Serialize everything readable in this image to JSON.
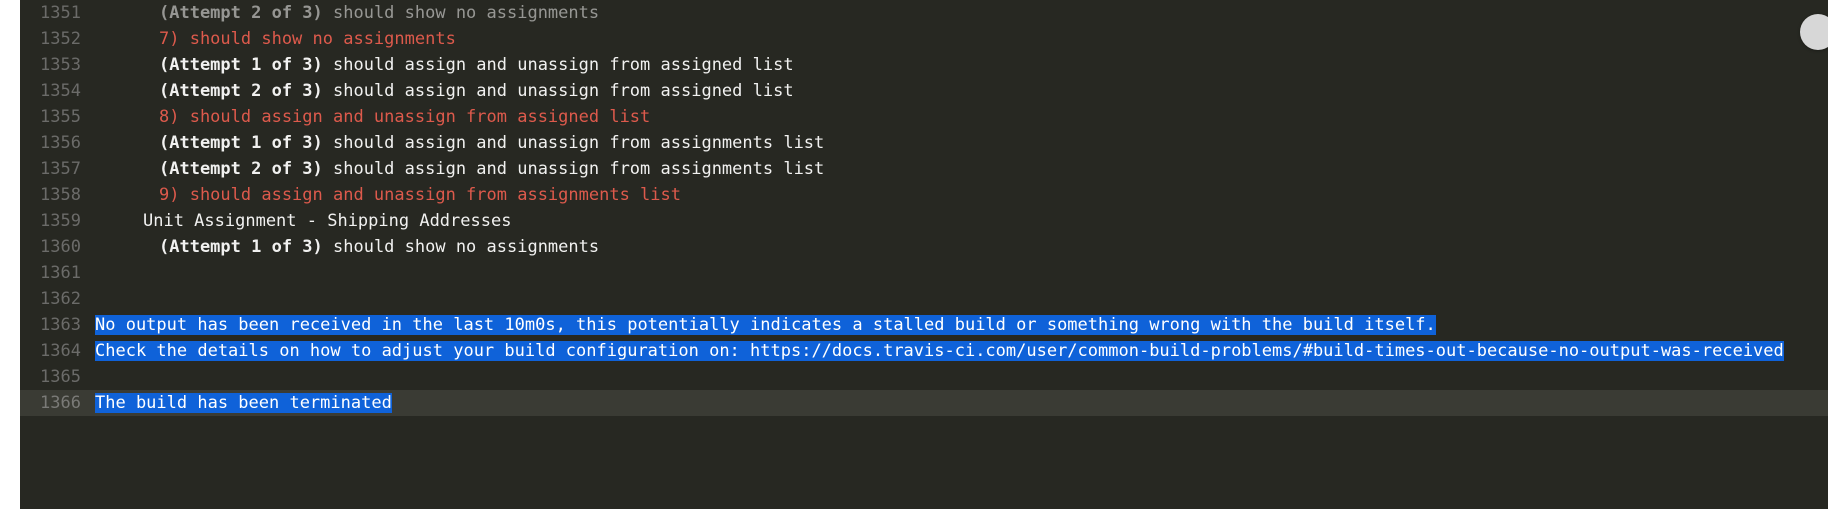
{
  "lines": [
    {
      "n": "1351",
      "cls": "partial",
      "segs": [
        {
          "cls": "indent2 bold dim-partial",
          "t": "(Attempt 2 of 3) "
        },
        {
          "cls": "dim-partial",
          "t": "should show no assignments"
        }
      ]
    },
    {
      "n": "1352",
      "segs": [
        {
          "cls": "indent2 red",
          "t": "7) should show no assignments"
        }
      ]
    },
    {
      "n": "1353",
      "segs": [
        {
          "cls": "indent2 bold",
          "t": "(Attempt 1 of 3) "
        },
        {
          "cls": "white",
          "t": "should assign and unassign from assigned list"
        }
      ]
    },
    {
      "n": "1354",
      "segs": [
        {
          "cls": "indent2 bold",
          "t": "(Attempt 2 of 3) "
        },
        {
          "cls": "white",
          "t": "should assign and unassign from assigned list"
        }
      ]
    },
    {
      "n": "1355",
      "segs": [
        {
          "cls": "indent2 red",
          "t": "8) should assign and unassign from assigned list"
        }
      ]
    },
    {
      "n": "1356",
      "segs": [
        {
          "cls": "indent2 bold",
          "t": "(Attempt 1 of 3) "
        },
        {
          "cls": "white",
          "t": "should assign and unassign from assignments list"
        }
      ]
    },
    {
      "n": "1357",
      "segs": [
        {
          "cls": "indent2 bold",
          "t": "(Attempt 2 of 3) "
        },
        {
          "cls": "white",
          "t": "should assign and unassign from assignments list"
        }
      ]
    },
    {
      "n": "1358",
      "segs": [
        {
          "cls": "indent2 red",
          "t": "9) should assign and unassign from assignments list"
        }
      ]
    },
    {
      "n": "1359",
      "segs": [
        {
          "cls": "indent1 white",
          "t": "Unit Assignment - Shipping Addresses"
        }
      ]
    },
    {
      "n": "1360",
      "segs": [
        {
          "cls": "indent2 bold",
          "t": "(Attempt 1 of 3) "
        },
        {
          "cls": "white",
          "t": "should show no assignments"
        }
      ]
    },
    {
      "n": "1361",
      "segs": [
        {
          "cls": "",
          "t": " "
        }
      ]
    },
    {
      "n": "1362",
      "segs": [
        {
          "cls": "",
          "t": " "
        }
      ]
    },
    {
      "n": "1363",
      "segs": [
        {
          "cls": "hlblue",
          "t": "No output has been received in the last 10m0s, this potentially indicates a stalled build or something wrong with the build itself."
        }
      ]
    },
    {
      "n": "1364",
      "segs": [
        {
          "cls": "hlblue",
          "t": "Check the details on how to adjust your build configuration on: https://docs.travis-ci.com/user/common-build-problems/#build-times-out-because-no-output-was-received"
        }
      ]
    },
    {
      "n": "1365",
      "segs": [
        {
          "cls": "",
          "t": " "
        }
      ]
    },
    {
      "n": "1366",
      "rowcls": "lastrow",
      "segs": [
        {
          "cls": "hlblue",
          "t": "The build has been terminated"
        }
      ]
    }
  ],
  "scroll_button_title": "Scroll"
}
